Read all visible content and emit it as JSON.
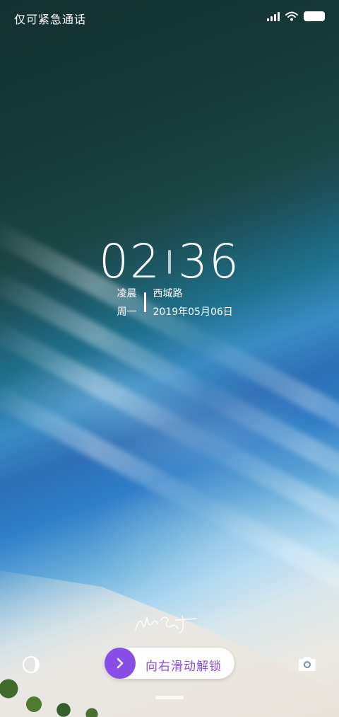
{
  "status_bar": {
    "carrier_text": "仅可紧急通话",
    "icons": [
      "signal-icon",
      "wifi-icon",
      "battery-icon"
    ]
  },
  "clock": {
    "hours": "02",
    "minutes": "36",
    "period": "凌晨",
    "weekday": "周一",
    "location": "西城路",
    "date": "2019年05月06日"
  },
  "unlock": {
    "label": "向右滑动解锁",
    "knob_icon": "chevron-right-icon",
    "accent_color": "#8a4ee8"
  },
  "bottom_icons": {
    "left": "control-center-icon",
    "right": "camera-icon"
  }
}
